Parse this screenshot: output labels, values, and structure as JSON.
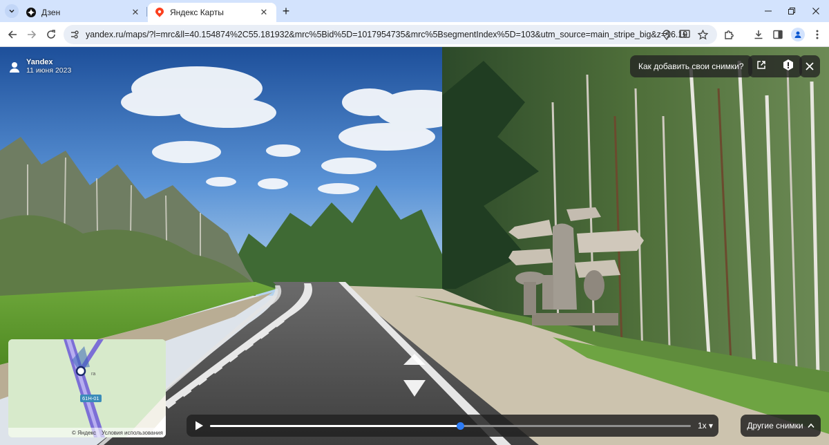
{
  "browser": {
    "tabs": [
      {
        "label": "Дзен",
        "icon": "dzen-icon",
        "active": false
      },
      {
        "label": "Яндекс Карты",
        "icon": "yandex-maps-pin-icon",
        "active": true
      }
    ],
    "url": "yandex.ru/maps/?l=mrc&ll=40.154874%2C55.181932&mrc%5Bid%5D=1017954735&mrc%5BsegmentIndex%5D=103&utm_source=main_stripe_big&z=16.19"
  },
  "panorama": {
    "author": "Yandex",
    "date": "11 июня 2023",
    "howto_label": "Как добавить свои снимки?",
    "other_photos_label": "Другие снимки",
    "speed_label": "1x",
    "progress": 0.52
  },
  "minimap": {
    "place_label": "га",
    "road_label": "61Н-01",
    "copyright": "© Яндекс",
    "terms": "Условия использования"
  },
  "colors": {
    "tabstrip": "#d3e3fd",
    "overlay": "#222222",
    "progress_thumb": "#2d7cf6",
    "maps_pin": "#fc3f1d"
  }
}
